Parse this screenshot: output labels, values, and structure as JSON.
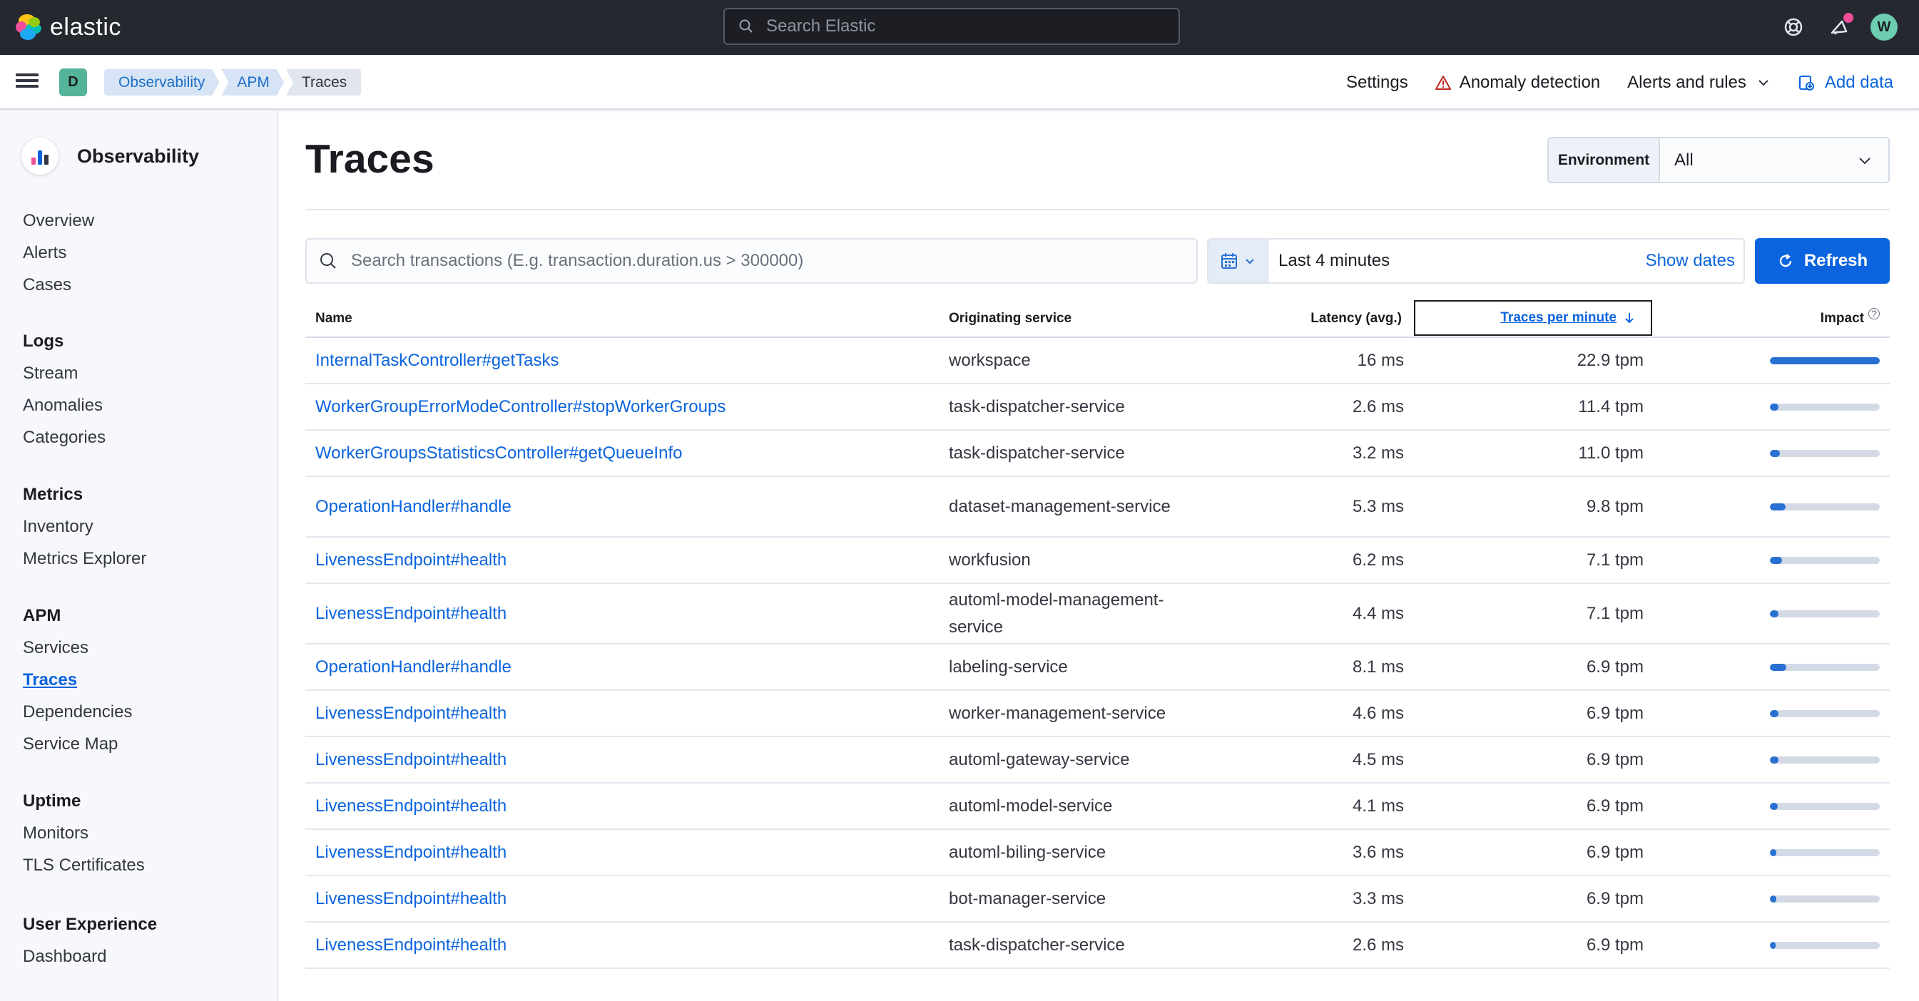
{
  "header": {
    "brand": "elastic",
    "search_placeholder": "Search Elastic",
    "avatar_initial": "W"
  },
  "breadcrumbs": {
    "space_initial": "D",
    "items": [
      "Observability",
      "APM",
      "Traces"
    ]
  },
  "toolbar_links": {
    "settings": "Settings",
    "anomaly_detection": "Anomaly detection",
    "alerts_and_rules": "Alerts and rules",
    "add_data": "Add data"
  },
  "sidebar": {
    "title": "Observability",
    "top_items": [
      "Overview",
      "Alerts",
      "Cases"
    ],
    "sections": [
      {
        "title": "Logs",
        "items": [
          "Stream",
          "Anomalies",
          "Categories"
        ]
      },
      {
        "title": "Metrics",
        "items": [
          "Inventory",
          "Metrics Explorer"
        ]
      },
      {
        "title": "APM",
        "items": [
          "Services",
          "Traces",
          "Dependencies",
          "Service Map"
        ]
      },
      {
        "title": "Uptime",
        "items": [
          "Monitors",
          "TLS Certificates"
        ]
      },
      {
        "title": "User Experience",
        "items": [
          "Dashboard"
        ]
      }
    ],
    "active_item": "Traces"
  },
  "main": {
    "title": "Traces",
    "environment": {
      "label": "Environment",
      "value": "All"
    },
    "search_placeholder": "Search transactions (E.g. transaction.duration.us > 300000)",
    "date_range": "Last 4 minutes",
    "show_dates": "Show dates",
    "refresh": "Refresh"
  },
  "table": {
    "columns": {
      "name": "Name",
      "service": "Originating service",
      "latency": "Latency (avg.)",
      "tpm": "Traces per minute",
      "impact": "Impact"
    },
    "rows": [
      {
        "name": "InternalTaskController#getTasks",
        "service": "workspace",
        "latency": "16 ms",
        "tpm": "22.9 tpm",
        "impact": 1.0
      },
      {
        "name": "WorkerGroupErrorModeController#stopWorkerGroups",
        "service": "task-dispatcher-service",
        "latency": "2.6 ms",
        "tpm": "11.4 tpm",
        "impact": 0.08
      },
      {
        "name": "WorkerGroupsStatisticsController#getQueueInfo",
        "service": "task-dispatcher-service",
        "latency": "3.2 ms",
        "tpm": "11.0 tpm",
        "impact": 0.09
      },
      {
        "name": "OperationHandler#handle",
        "service": "dataset-management-service",
        "latency": "5.3 ms",
        "tpm": "9.8 tpm",
        "impact": 0.14
      },
      {
        "name": "LivenessEndpoint#health",
        "service": "workfusion",
        "latency": "6.2 ms",
        "tpm": "7.1 tpm",
        "impact": 0.11
      },
      {
        "name": "LivenessEndpoint#health",
        "service": "automl-model-management-service",
        "latency": "4.4 ms",
        "tpm": "7.1 tpm",
        "impact": 0.08
      },
      {
        "name": "OperationHandler#handle",
        "service": "labeling-service",
        "latency": "8.1 ms",
        "tpm": "6.9 tpm",
        "impact": 0.15
      },
      {
        "name": "LivenessEndpoint#health",
        "service": "worker-management-service",
        "latency": "4.6 ms",
        "tpm": "6.9 tpm",
        "impact": 0.08
      },
      {
        "name": "LivenessEndpoint#health",
        "service": "automl-gateway-service",
        "latency": "4.5 ms",
        "tpm": "6.9 tpm",
        "impact": 0.08
      },
      {
        "name": "LivenessEndpoint#health",
        "service": "automl-model-service",
        "latency": "4.1 ms",
        "tpm": "6.9 tpm",
        "impact": 0.07
      },
      {
        "name": "LivenessEndpoint#health",
        "service": "automl-biling-service",
        "latency": "3.6 ms",
        "tpm": "6.9 tpm",
        "impact": 0.06
      },
      {
        "name": "LivenessEndpoint#health",
        "service": "bot-manager-service",
        "latency": "3.3 ms",
        "tpm": "6.9 tpm",
        "impact": 0.06
      },
      {
        "name": "LivenessEndpoint#health",
        "service": "task-dispatcher-service",
        "latency": "2.6 ms",
        "tpm": "6.9 tpm",
        "impact": 0.05
      }
    ]
  }
}
